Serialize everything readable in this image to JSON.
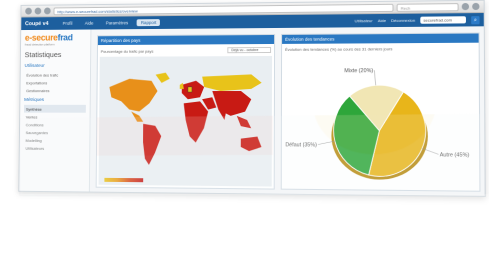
{
  "browser": {
    "url": "http://www.e-securefrad.com/statistics/overview",
    "search_placeholder": "Rech"
  },
  "app": {
    "brand": "Coupé v4",
    "menus": [
      "Profil",
      "Aide",
      "Paramètres",
      "Rapport"
    ],
    "active_menu": 3,
    "links": [
      "Utilisateur",
      "Aide",
      "Déconnexion"
    ],
    "select_value": "securefrad.com"
  },
  "sidebar": {
    "logo_main": "e-secure",
    "logo_accent": "frad",
    "tagline": "fraud detection platform",
    "title": "Statistiques",
    "sections": [
      {
        "label": "Utilisateur",
        "items": [
          "Évolution des trafic",
          "Exportations",
          "Gestionnaires"
        ]
      },
      {
        "label": "Métriques",
        "items": [
          "Synthèse",
          "Ventes",
          "Conditions",
          "Sauvegardes",
          "Modelling",
          "Utilisateurs"
        ]
      }
    ],
    "active_item": "Synthèse"
  },
  "map_panel": {
    "title": "Répartition des pays",
    "subtitle": "Pourcentage du trafic par pays",
    "select": "Déjà vu - octobre",
    "colors": {
      "low": "#e8c31a",
      "mid": "#e8901a",
      "high": "#c81a14"
    }
  },
  "pie_panel": {
    "title": "Évolution des tendances",
    "subtitle": "Évolution des tendances (%) au cours des 31 derniers jours",
    "colors": [
      "#e8b51a",
      "#2ea63a",
      "#f1e6b4"
    ],
    "chart_data": {
      "type": "pie",
      "labels": [
        "Autre (45%)",
        "Défaut (35%)",
        "Mixte (20%)"
      ],
      "values": [
        45,
        35,
        20
      ]
    }
  }
}
